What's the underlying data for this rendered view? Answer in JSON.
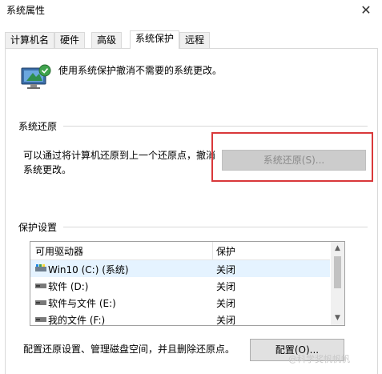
{
  "window": {
    "title": "系统属性",
    "close_glyph": "✕"
  },
  "tabs": [
    {
      "label": "计算机名"
    },
    {
      "label": "硬件"
    },
    {
      "label": "高级"
    },
    {
      "label": "系统保护"
    },
    {
      "label": "远程"
    }
  ],
  "active_tab": "系统保护",
  "intro": {
    "text": "使用系统保护撤消不需要的系统更改。",
    "icon": "monitor-shield-icon"
  },
  "restore_section": {
    "title": "系统还原",
    "description": "可以通过将计算机还原到上一个还原点，撤消系统更改。",
    "button_label": "系统还原(S)...",
    "button_enabled": false
  },
  "protection_section": {
    "title": "保护设置",
    "columns": [
      "可用驱动器",
      "保护"
    ],
    "drives": [
      {
        "name": "Win10 (C:) (系统)",
        "status": "关闭",
        "icon": "system-drive-icon"
      },
      {
        "name": "软件 (D:)",
        "status": "关闭",
        "icon": "drive-icon"
      },
      {
        "name": "软件与文件 (E:)",
        "status": "关闭",
        "icon": "drive-icon"
      },
      {
        "name": "我的文件 (F:)",
        "status": "关闭",
        "icon": "drive-icon"
      }
    ]
  },
  "config": {
    "text": "配置还原设置、管理磁盘空间，并且删除还原点。",
    "button_label": "配置(O)..."
  },
  "watermark": "@科学奖帆帆帆",
  "colors": {
    "highlight": "#d9383a",
    "selected_row": "#e5f3ff",
    "disabled_button": "#cccccc"
  }
}
